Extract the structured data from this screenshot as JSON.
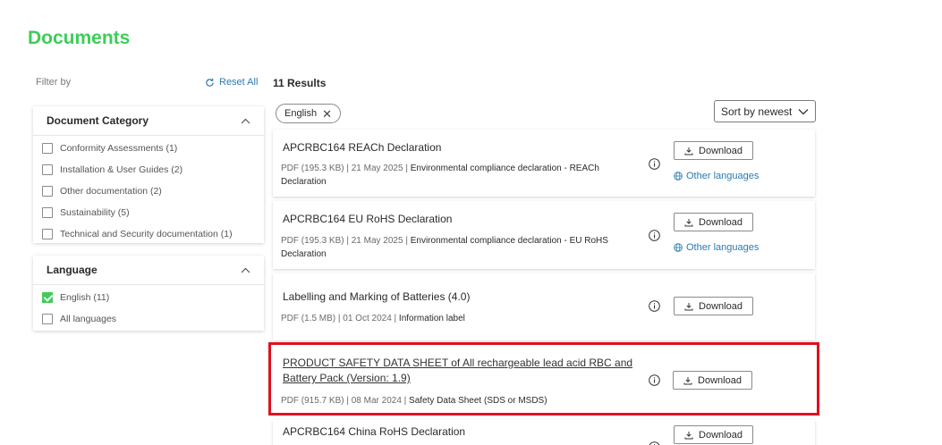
{
  "page": {
    "title": "Documents"
  },
  "filters": {
    "label": "Filter by",
    "reset_label": "Reset All",
    "category": {
      "title": "Document Category",
      "options": [
        {
          "label": "Conformity Assessments (1)",
          "checked": false
        },
        {
          "label": "Installation & User Guides (2)",
          "checked": false
        },
        {
          "label": "Other documentation (2)",
          "checked": false
        },
        {
          "label": "Sustainability (5)",
          "checked": false
        },
        {
          "label": "Technical and Security documentation (1)",
          "checked": false
        }
      ]
    },
    "language": {
      "title": "Language",
      "options": [
        {
          "label": "English (11)",
          "checked": true
        },
        {
          "label": "All languages",
          "checked": false
        }
      ]
    }
  },
  "results": {
    "count_label": "11 Results",
    "active_chip": "English",
    "sort_label": "Sort by newest",
    "download_label": "Download",
    "other_languages_label": "Other languages",
    "items": [
      {
        "title": "APCRBC164 REACh Declaration",
        "meta": "PDF (195.3 KB) | 21 May 2025 | ",
        "type": "Environmental compliance declaration - REACh Declaration"
      },
      {
        "title": "APCRBC164 EU RoHS Declaration",
        "meta": "PDF (195.3 KB) | 21 May 2025 | ",
        "type": "Environmental compliance declaration - EU RoHS Declaration"
      },
      {
        "title": "Labelling and Marking of Batteries (4.0)",
        "meta": "PDF (1.5 MB) | 01 Oct 2024 | ",
        "type": "Information label"
      },
      {
        "title": "PRODUCT SAFETY DATA SHEET of All rechargeable lead acid RBC and Battery Pack (Version: 1.9)",
        "meta": "PDF (915.7 KB) | 08 Mar 2024 | ",
        "type": "Safety Data Sheet (SDS or MSDS)"
      },
      {
        "title": "APCRBC164 China RoHS Declaration",
        "meta": "",
        "type": ""
      }
    ]
  },
  "colors": {
    "accent": "#3dcd58",
    "link": "#2a7ab0",
    "highlight": "#e0101e"
  }
}
